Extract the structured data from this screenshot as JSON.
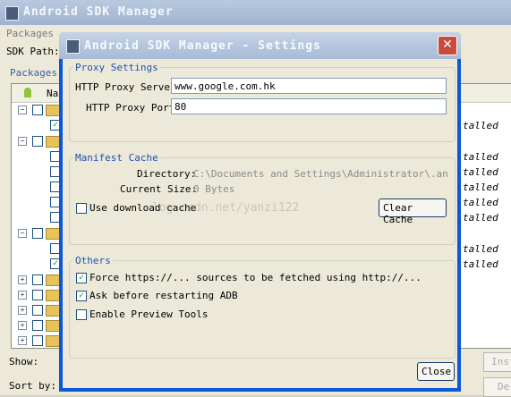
{
  "main": {
    "title": "Android SDK Manager",
    "menu": "Packages",
    "sdk_path_label": "SDK Path:",
    "packages_tab": "Packages",
    "name_col": "Na",
    "row_status_prefix": "...",
    "statuses": [
      "talled",
      "talled",
      "talled",
      "talled",
      "talled",
      "talled",
      "talled",
      "talled"
    ],
    "show_label": "Show:",
    "sort_label": "Sort by:",
    "install_button": "Inst",
    "delete_button": "De"
  },
  "dialog": {
    "title": "Android SDK Manager - Settings",
    "proxy": {
      "group": "Proxy Settings",
      "server_label": "HTTP Proxy Server",
      "server_value": "www.google.com.hk",
      "port_label": "HTTP Proxy Port",
      "port_value": "80"
    },
    "manifest": {
      "group": "Manifest Cache",
      "directory_label": "Directory:",
      "directory_value": "C:\\Documents and Settings\\Administrator\\.androi",
      "size_label": "Current Size:",
      "size_value": "0 Bytes",
      "use_download_cache": "Use download cache",
      "clear_cache": "Clear Cache"
    },
    "others": {
      "group": "Others",
      "force_https": "Force https://... sources to be fetched using http://...",
      "ask_restart": "Ask before restarting ADB",
      "enable_preview": "Enable Preview Tools"
    },
    "close_button": "Close",
    "watermark": "log.csdn.net/yanzi122"
  }
}
